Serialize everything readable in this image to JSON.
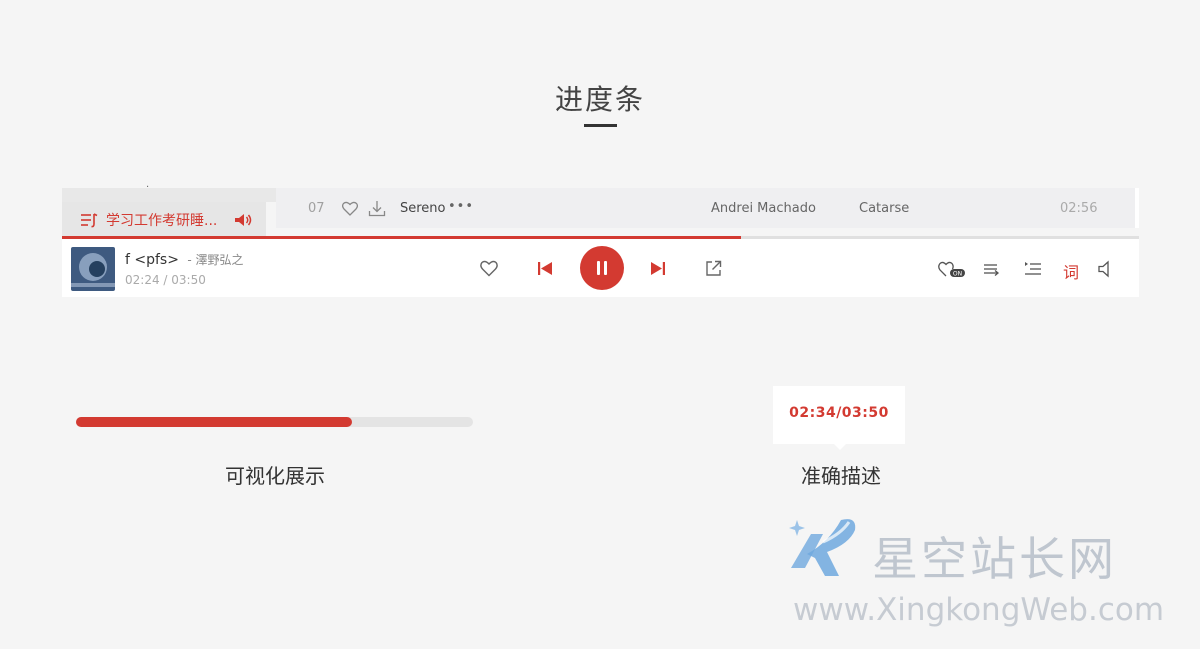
{
  "section": {
    "title": "进度条"
  },
  "sidebar": {
    "top_partial_text": "·",
    "now_playing_label": "学习工作考研睡..."
  },
  "track": {
    "number": "07",
    "name": "Sereno",
    "more": "•••",
    "artist": "Andrei Machado",
    "album": "Catarse",
    "duration": "02:56"
  },
  "player": {
    "progress_fraction": 0.63,
    "song_title": "f <pfs>",
    "song_artist": "- 澤野弘之",
    "current_time": "02:24 /",
    "total_time": "03:50",
    "lyric_label": "词",
    "heart_mode_badge": "ON"
  },
  "demo": {
    "progress_fraction": 0.695,
    "caption_left": "可视化展示",
    "tooltip_time": "02:34/03:50",
    "caption_right": "准确描述"
  },
  "watermark": {
    "name": "星空站长网",
    "url": "www.XingkongWeb.com"
  },
  "colors": {
    "accent": "#d33a31",
    "background": "#f5f5f5",
    "panel": "#ffffff",
    "track_row": "#efeff1"
  }
}
